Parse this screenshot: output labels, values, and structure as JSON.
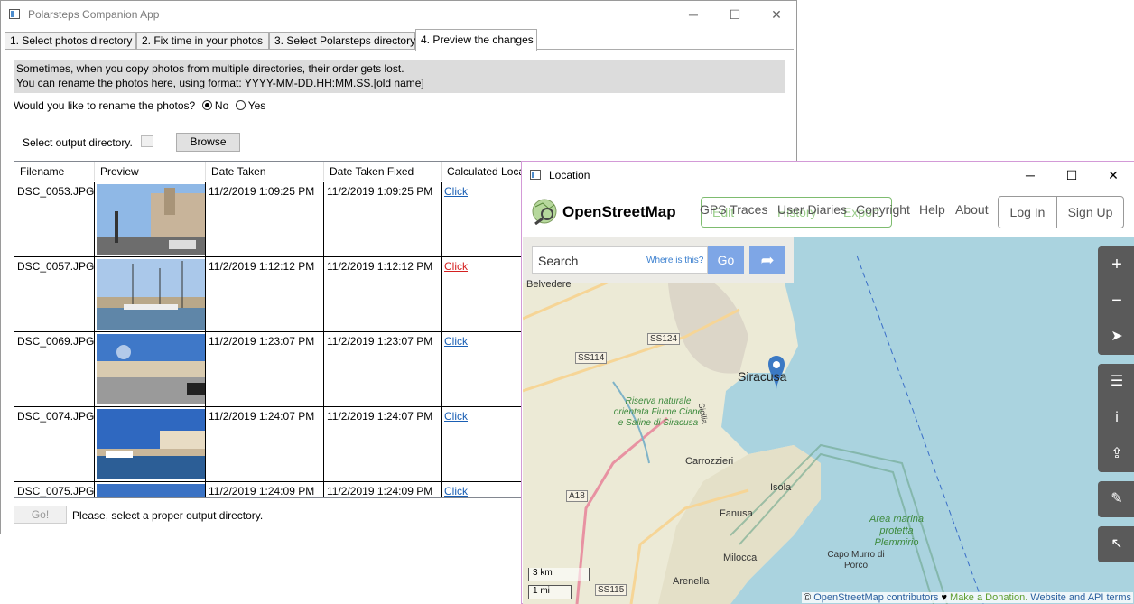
{
  "main_window": {
    "title": "Polarsteps Companion App",
    "controls": {
      "minimize": "─",
      "maximize": "☐",
      "close": "✕"
    },
    "tabs": [
      {
        "label": "1. Select photos directory"
      },
      {
        "label": "2. Fix time in your photos"
      },
      {
        "label": "3. Select Polarsteps directory"
      },
      {
        "label": "4. Preview the changes"
      }
    ],
    "info_line1": "Sometimes, when you copy photos from multiple directories, their order gets lost.",
    "info_line2": "You can rename the photos here, using format: YYYY-MM-DD.HH:MM.SS.[old name]",
    "rename_question": "Would you like to rename the photos?",
    "rename_options": {
      "no": "No",
      "yes": "Yes",
      "selected": "No"
    },
    "output_label": "Select output directory.",
    "browse_label": "Browse",
    "columns": [
      "Filename",
      "Preview",
      "Date Taken",
      "Date Taken Fixed",
      "Calculated Location"
    ],
    "rows": [
      {
        "filename": "DSC_0053.JPG",
        "date_taken": "11/2/2019 1:09:25 PM",
        "date_fixed": "11/2/2019 1:09:25 PM",
        "location": "Click",
        "link_color": "#1a5fb4"
      },
      {
        "filename": "DSC_0057.JPG",
        "date_taken": "11/2/2019 1:12:12 PM",
        "date_fixed": "11/2/2019 1:12:12 PM",
        "location": "Click",
        "link_color": "#d42020"
      },
      {
        "filename": "DSC_0069.JPG",
        "date_taken": "11/2/2019 1:23:07 PM",
        "date_fixed": "11/2/2019 1:23:07 PM",
        "location": "Click",
        "link_color": "#1a5fb4"
      },
      {
        "filename": "DSC_0074.JPG",
        "date_taken": "11/2/2019 1:24:07 PM",
        "date_fixed": "11/2/2019 1:24:07 PM",
        "location": "Click",
        "link_color": "#1a5fb4"
      },
      {
        "filename": "DSC_0075.JPG",
        "date_taken": "11/2/2019 1:24:09 PM",
        "date_fixed": "11/2/2019 1:24:09 PM",
        "location": "Click",
        "link_color": "#1a5fb4"
      }
    ],
    "go_label": "Go!",
    "status": "Please, select a proper output directory."
  },
  "location_window": {
    "title": "Location",
    "controls": {
      "minimize": "─",
      "maximize": "☐",
      "close": "✕"
    },
    "osm": {
      "brand": "OpenStreetMap",
      "nav_overlap": [
        "GPS Traces",
        "User Diaries",
        "Copyright",
        "Help",
        "About"
      ],
      "nav_ghost": [
        "Edit",
        "History",
        "Export"
      ],
      "login": "Log In",
      "signup": "Sign Up",
      "search_placeholder": "Search",
      "where_is_this": "Where is this?",
      "go": "Go",
      "map_labels": {
        "belvedere": "Belvedere",
        "ss124": "SS124",
        "ss114": "SS114",
        "siracusa": "Siracusa",
        "reserve": "Riserva naturale orientata Fiume Ciane e Saline di Siracusa",
        "sicilia": "Sicilia",
        "carrozzieri": "Carrozzieri",
        "a18": "A18",
        "isola": "Isola",
        "fanusa": "Fanusa",
        "area_marina": "Area marina protetta Plemmirio",
        "milocca": "Milocca",
        "capo_murro": "Capo Murro di Porco",
        "arenella": "Arenella",
        "ss115": "SS115"
      },
      "scale_km": "3 km",
      "scale_mi": "1 mi",
      "attribution_prefix": "©",
      "attribution_link": "OpenStreetMap contributors",
      "attribution_heart": "♥",
      "attribution_donate": "Make a Donation.",
      "attribution_terms": "Website and API terms"
    }
  }
}
